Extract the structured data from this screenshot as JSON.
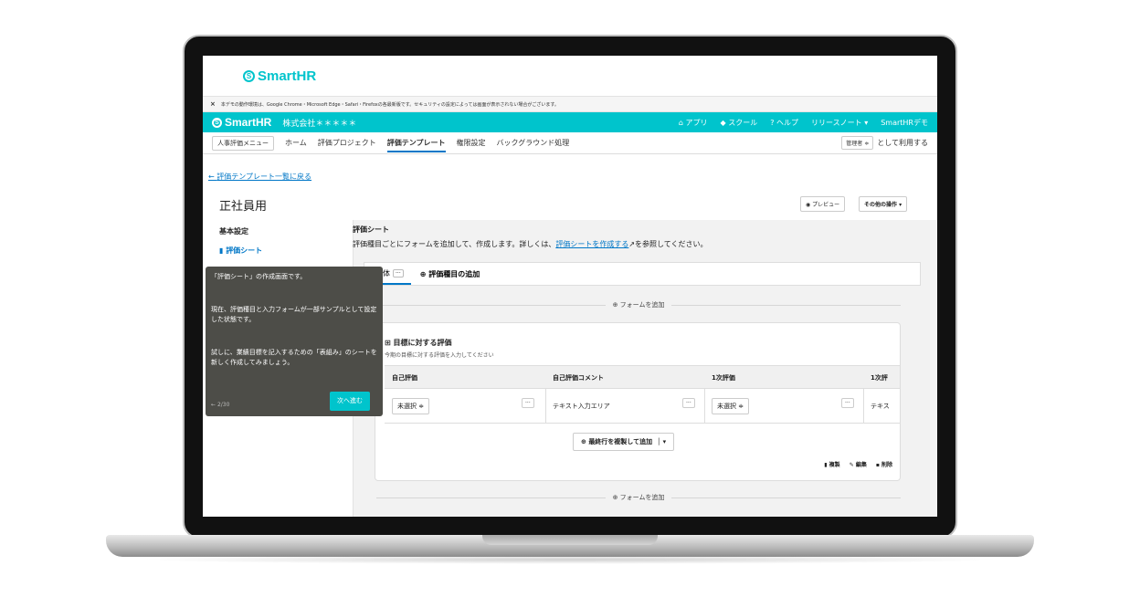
{
  "brand": {
    "name": "SmartHR"
  },
  "notice": "本デモの動作環境は、Google Chrome・Microsoft Edge・Safari・Firefoxの各最新版です。セキュリティの設定によっては画面が表示されない場合がございます。",
  "appbar": {
    "company": "株式会社＊＊＊＊＊",
    "links": [
      "アプリ",
      "スクール",
      "ヘルプ",
      "リリースノート",
      "SmartHRデモ"
    ]
  },
  "nav": {
    "menu_button": "人事評価メニュー",
    "items": [
      "ホーム",
      "評価プロジェクト",
      "評価テンプレート",
      "権限設定",
      "バックグラウンド処理"
    ],
    "active_index": 2,
    "role": "管理者",
    "use_as": "として利用する"
  },
  "page": {
    "back": "評価テンプレート一覧に戻る",
    "title": "正社員用",
    "preview": "プレビュー",
    "other_ops": "その他の操作"
  },
  "sidebar": {
    "section": "基本設定",
    "item": "評価シート"
  },
  "sheet": {
    "heading": "評価シート",
    "desc_before": "評価種目ごとにフォームを追加して、作成します。詳しくは、",
    "desc_link": "評価シートを作成する",
    "desc_after": "を参照してください。"
  },
  "tabs": {
    "tab1": "体",
    "tab2": "評価種目の追加"
  },
  "add_form": "フォームを追加",
  "card": {
    "title": "目標に対する評価",
    "subtitle": "今期の目標に対する評価を入力してください",
    "columns": [
      "自己評価",
      "自己評価コメント",
      "1次評価",
      "1次評"
    ],
    "row": {
      "sel1": "未選択 ≑",
      "text_area": "テキスト入力エリア",
      "sel2": "未選択 ≑",
      "text_cut": "テキス"
    },
    "add_row": "最終行を複製して追加",
    "actions": [
      "複製",
      "編集",
      "削除"
    ]
  },
  "tooltip": {
    "p1": "「評価シート」の作成画面です。",
    "p2": "現在、評価種目と入力フォームが一部サンプルとして設定した状態です。",
    "p3": "試しに、業績目標を記入するための「表組み」のシートを新しく作成してみましょう。",
    "step": "2/30",
    "next": "次へ進む"
  }
}
